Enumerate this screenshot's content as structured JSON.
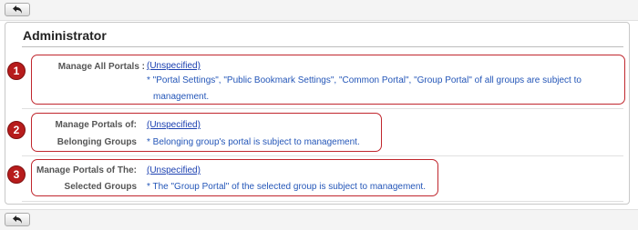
{
  "toolbar": {
    "back_icon": "back-arrow-icon"
  },
  "panel": {
    "title": "Administrator",
    "rows": [
      {
        "number": "1",
        "label": "Manage All Portals :",
        "link": "(Unspecified)",
        "desc_line1": "* \"Portal Settings\", \"Public Bookmark Settings\", \"Common Portal\", \"Group Portal\" of all groups are subject to",
        "desc_line2": "management."
      },
      {
        "number": "2",
        "label_line1": "Manage Portals of:",
        "label_line2": "Belonging Groups",
        "link": "(Unspecified)",
        "desc": "* Belonging group's portal is subject to management."
      },
      {
        "number": "3",
        "label_line1": "Manage Portals of The:",
        "label_line2": "Selected Groups",
        "link": "(Unspecified)",
        "desc": "* The \"Group Portal\" of the selected group is subject to management."
      }
    ]
  },
  "colors": {
    "callout": "#c0262d",
    "badge": "#b71c1c",
    "link": "#1a3fb0",
    "desc": "#2456b8"
  }
}
